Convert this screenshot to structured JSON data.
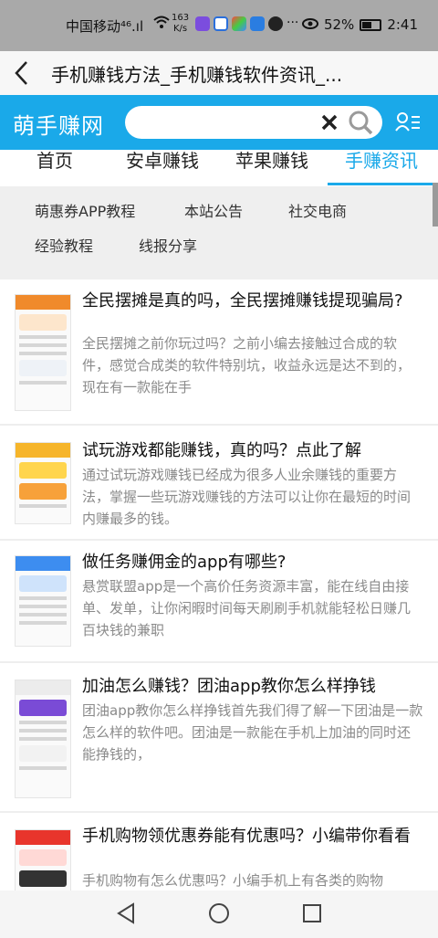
{
  "status_bar": {
    "carrier": "中国移动⁴⁶.ıl",
    "net_speed_value": "163",
    "net_speed_unit": "K/s",
    "more": "···",
    "battery_percent": "52%",
    "time": "2:41"
  },
  "title_bar": {
    "title": "手机赚钱方法_手机赚钱软件资讯_..."
  },
  "site_header": {
    "logo": "萌手赚网",
    "search_placeholder": "",
    "accent_color": "#1aa9e9"
  },
  "tabs": [
    {
      "label": "首页"
    },
    {
      "label": "安卓赚钱"
    },
    {
      "label": "苹果赚钱"
    },
    {
      "label": "手赚资讯"
    }
  ],
  "active_tab": "手赚资讯",
  "sub_nav": [
    {
      "label": "萌惠券APP教程"
    },
    {
      "label": "本站公告"
    },
    {
      "label": "社交电商"
    },
    {
      "label": "经验教程"
    },
    {
      "label": "线报分享"
    }
  ],
  "articles": [
    {
      "title": "全民摆摊是真的吗，全民摆摊赚钱提现骗局?",
      "desc": "全民摆摊之前你玩过吗？之前小编去接触过合成的软件，感觉合成类的软件特别坑，收益永远是达不到的，现在有一款能在手"
    },
    {
      "title": "试玩游戏都能赚钱，真的吗？点此了解",
      "desc": "通过试玩游戏赚钱已经成为很多人业余赚钱的重要方法，掌握一些玩游戏赚钱的方法可以让你在最短的时间内赚最多的钱。"
    },
    {
      "title": "做任务赚佣金的app有哪些?",
      "desc": "悬赏联盟app是一个高价任务资源丰富，能在线自由接单、发单，让你闲暇时间每天刷刷手机就能轻松日赚几百块钱的兼职"
    },
    {
      "title": "加油怎么赚钱？团油app教你怎么样挣钱",
      "desc": "团油app教你怎么样挣钱首先我们得了解一下团油是一款怎么样的软件吧。团油是一款能在手机上加油的同时还能挣钱的，"
    },
    {
      "title": "手机购物领优惠券能有优惠吗？小编带你看看",
      "desc": "手机购物有怎么优惠吗？小编手机上有各类的购物"
    }
  ],
  "icons": {
    "back": "back-arrow-icon",
    "clear": "clear-icon",
    "search": "search-icon",
    "user_menu": "user-menu-icon",
    "nav_back": "nav-back-icon",
    "nav_home": "nav-home-icon",
    "nav_recents": "nav-recents-icon"
  }
}
